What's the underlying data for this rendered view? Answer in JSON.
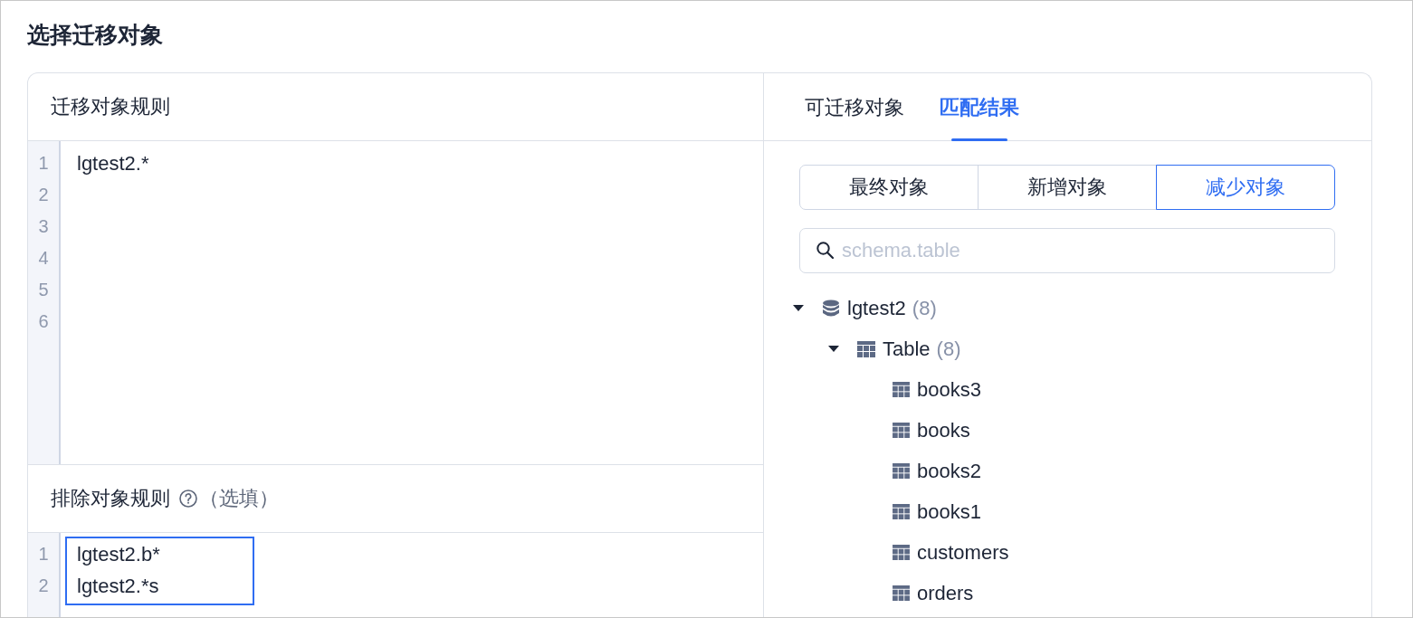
{
  "page": {
    "title": "选择迁移对象"
  },
  "rules_panel": {
    "title": "迁移对象规则",
    "editor": {
      "line_numbers": [
        "1",
        "2",
        "3",
        "4",
        "5",
        "6"
      ],
      "lines": [
        "lgtest2.*"
      ]
    }
  },
  "exclude_panel": {
    "title": "排除对象规则",
    "optional_note": "（选填）",
    "editor": {
      "line_numbers": [
        "1",
        "2"
      ],
      "lines": [
        "lgtest2.b*",
        "lgtest2.*s"
      ],
      "highlighted": true
    }
  },
  "result_panel": {
    "tabs": [
      {
        "label": "可迁移对象",
        "selected": false
      },
      {
        "label": "匹配结果",
        "selected": true
      }
    ],
    "filters": [
      {
        "label": "最终对象",
        "selected": false
      },
      {
        "label": "新增对象",
        "selected": false
      },
      {
        "label": "减少对象",
        "selected": true
      }
    ],
    "search": {
      "placeholder": "schema.table"
    },
    "tree": [
      {
        "kind": "schema",
        "label": "lgtest2",
        "count": "(8)",
        "expanded": true,
        "children": [
          {
            "kind": "group",
            "label": "Table",
            "count": "(8)",
            "expanded": true,
            "children": [
              {
                "kind": "table",
                "label": "books3"
              },
              {
                "kind": "table",
                "label": "books"
              },
              {
                "kind": "table",
                "label": "books2"
              },
              {
                "kind": "table",
                "label": "books1"
              },
              {
                "kind": "table",
                "label": "customers"
              },
              {
                "kind": "table",
                "label": "orders"
              }
            ]
          }
        ]
      }
    ]
  }
}
